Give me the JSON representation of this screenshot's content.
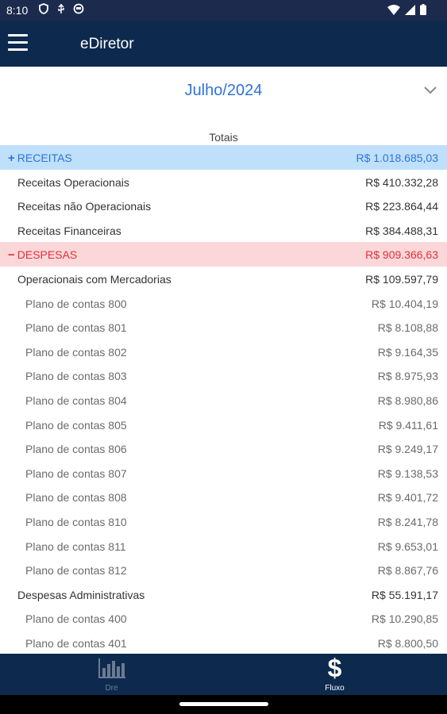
{
  "status_bar": {
    "time": "8:10"
  },
  "app_bar": {
    "title": "eDiretor"
  },
  "period": {
    "selected": "Julho/2024"
  },
  "totals_label": "Totais",
  "rows": [
    {
      "label": "RECEITAS",
      "value": "R$ 1.018.685,03",
      "kind": "cat",
      "style": "receitas",
      "sign": "+"
    },
    {
      "label": "Receitas Operacionais",
      "value": "R$ 410.332,28",
      "kind": "sub"
    },
    {
      "label": "Receitas não Operacionais",
      "value": "R$ 223.864,44",
      "kind": "sub"
    },
    {
      "label": "Receitas Financeiras",
      "value": "R$ 384.488,31",
      "kind": "sub"
    },
    {
      "label": "DESPESAS",
      "value": "R$ 909.366,63",
      "kind": "cat",
      "style": "despesas",
      "sign": "−"
    },
    {
      "label": "Operacionais com Mercadorias",
      "value": "R$ 109.597,79",
      "kind": "sub"
    },
    {
      "label": "Plano de contas 800",
      "value": "R$ 10.404,19",
      "kind": "leaf"
    },
    {
      "label": "Plano de contas 801",
      "value": "R$ 8.108,88",
      "kind": "leaf"
    },
    {
      "label": "Plano de contas 802",
      "value": "R$ 9.164,35",
      "kind": "leaf"
    },
    {
      "label": "Plano de contas 803",
      "value": "R$ 8.975,93",
      "kind": "leaf"
    },
    {
      "label": "Plano de contas 804",
      "value": "R$ 8.980,86",
      "kind": "leaf"
    },
    {
      "label": "Plano de contas 805",
      "value": "R$ 9.411,61",
      "kind": "leaf"
    },
    {
      "label": "Plano de contas 806",
      "value": "R$ 9.249,17",
      "kind": "leaf"
    },
    {
      "label": "Plano de contas 807",
      "value": "R$ 9.138,53",
      "kind": "leaf"
    },
    {
      "label": "Plano de contas 808",
      "value": "R$ 9.401,72",
      "kind": "leaf"
    },
    {
      "label": "Plano de contas 810",
      "value": "R$ 8.241,78",
      "kind": "leaf"
    },
    {
      "label": "Plano de contas 811",
      "value": "R$ 9.653,01",
      "kind": "leaf"
    },
    {
      "label": "Plano de contas 812",
      "value": "R$ 8.867,76",
      "kind": "leaf"
    },
    {
      "label": "Despesas Administrativas",
      "value": "R$ 55.191,17",
      "kind": "sub"
    },
    {
      "label": "Plano de contas 400",
      "value": "R$ 10.290,85",
      "kind": "leaf"
    },
    {
      "label": "Plano de contas 401",
      "value": "R$ 8.800,50",
      "kind": "leaf"
    }
  ],
  "bottom_nav": [
    {
      "label": "Dre",
      "icon": "bar-chart-icon",
      "active": false
    },
    {
      "label": "Fluxo",
      "icon": "dollar-icon",
      "active": true
    }
  ],
  "colors": {
    "primary": "#0d2a4e",
    "accent": "#2f73d8",
    "receitas_bg": "#bfe0fb",
    "despesas_bg": "#fcd7d9",
    "despesas_text": "#e0313c"
  }
}
